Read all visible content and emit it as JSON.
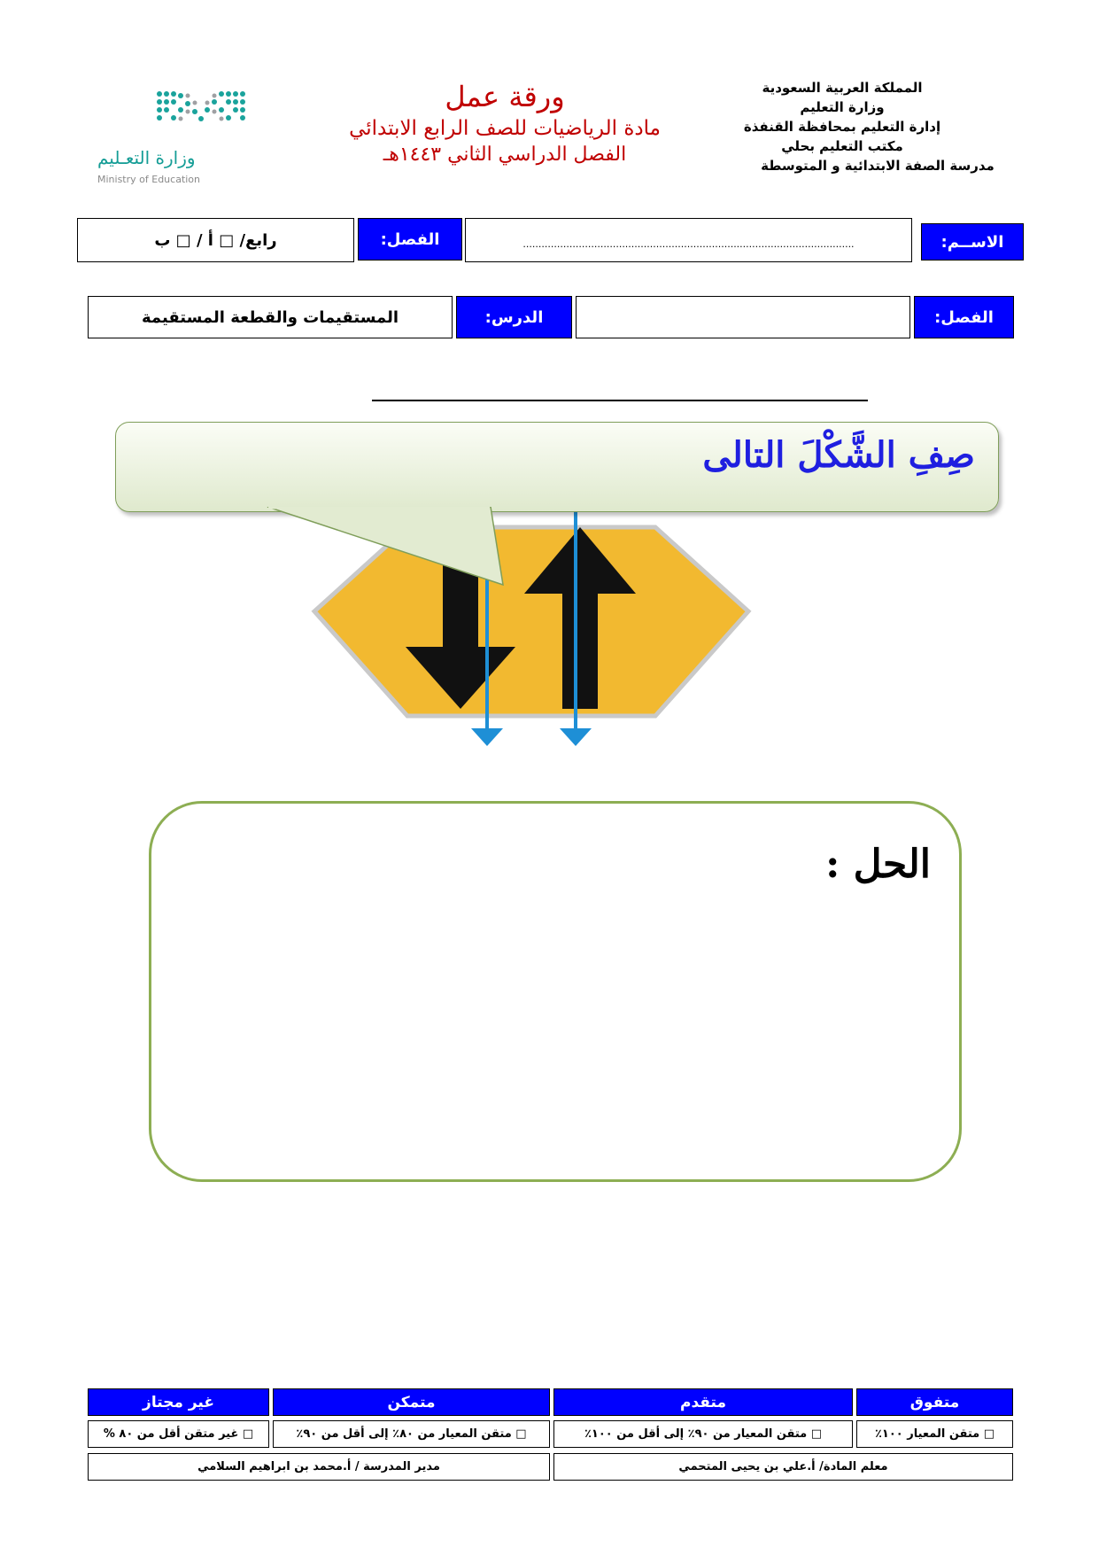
{
  "header": {
    "kingdom_lines": [
      "المملكة العربية السعودية",
      "وزارة التعليم",
      "إدارة التعليم بمحافظة القنفذة",
      "مكتب التعليم بحلي",
      "مدرسة الصفة الابتدائية و المتوسطة"
    ],
    "title": "ورقة عمل",
    "subject": "مادة الرياضيات للصف الرابع الابتدائي",
    "term": "الفصل الدراسي الثاني ١٤٤٣هـ",
    "logo_ar": "وزارة التعـليم",
    "logo_en": "Ministry of Education"
  },
  "info_row1": {
    "name_label": "الاســم:",
    "name_dots": "...........................................................................................................",
    "class_label": "الفصل:",
    "class_value": "رابع/ □ أ  /  □ ب"
  },
  "info_row2": {
    "chapter_label": "الفصل:",
    "chapter_value": "",
    "lesson_label": "الدرس:",
    "lesson_value": "المستقيمات والقطعة المستقيمة"
  },
  "question": {
    "prompt": "صِفِ الشَّكْلَ التالى"
  },
  "answer": {
    "label": "الحل :"
  },
  "footer": {
    "levels": [
      "متفوق",
      "متقدم",
      "متمكن",
      "غير مجتاز"
    ],
    "criteria": [
      "□ متقن المعيار ١٠٠٪",
      "□ متقن المعيار من ٩٠٪  إلى أقل من ١٠٠٪",
      "□ متقن المعيار من ٨٠٪ إلى أقل من ٩٠٪",
      "□ غير متقن أقل من ٨٠ %"
    ],
    "teacher": "معلم المادة/ أ.علي بن يحيى المتحمي",
    "principal": "مدير المدرسة / أ.محمد بن ابراهيم السلامي"
  },
  "colors": {
    "title_red": "#c00000",
    "label_blue": "#0000ff",
    "prompt_blue": "#1f1fe0",
    "answer_border": "#8dae53",
    "sign_yellow": "#f2b930",
    "line_blue": "#1e8fd6",
    "logo_teal": "#159d96"
  }
}
